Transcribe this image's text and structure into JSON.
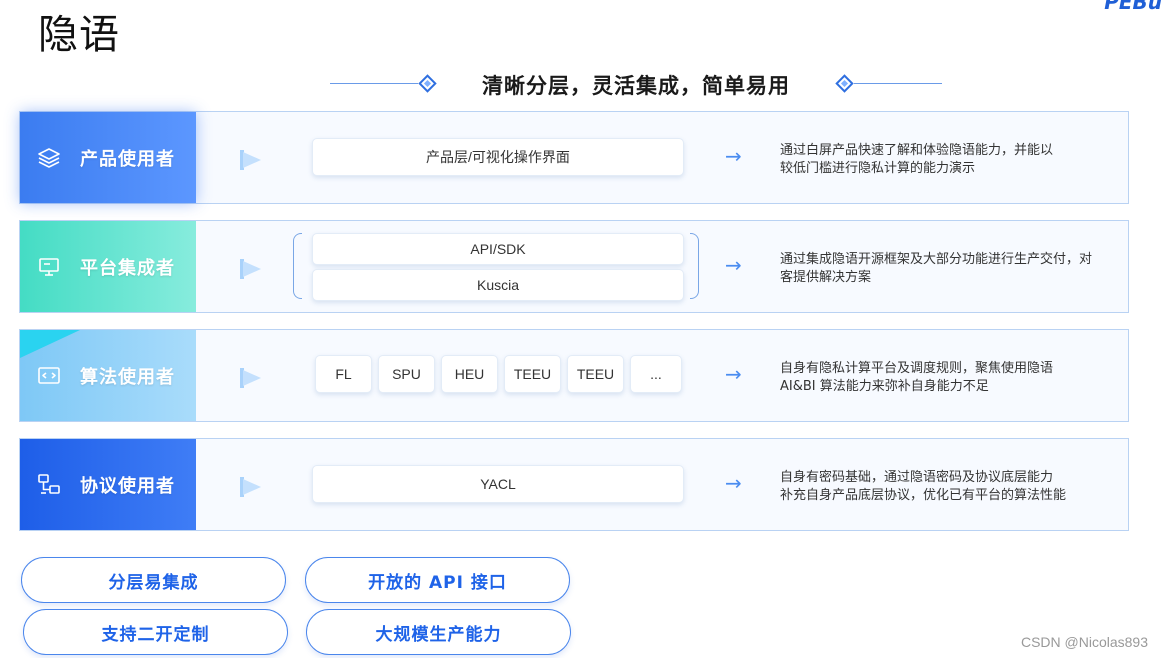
{
  "page_title": "隐语",
  "corner_logo": "PEBu",
  "subtitle": "清晰分层，灵活集成，简单易用",
  "layers": [
    {
      "role": "产品使用者",
      "icon": "layers-icon",
      "components": [
        "产品层/可视化操作界面"
      ],
      "description_lines": [
        "通过白屏产品快速了解和体验隐语能力，并能以",
        "较低门槛进行隐私计算的能力演示"
      ]
    },
    {
      "role": "平台集成者",
      "icon": "monitor-icon",
      "components": [
        "API/SDK",
        "Kuscia"
      ],
      "description_lines": [
        "通过集成隐语开源框架及大部分功能进行生产交付，对",
        "客提供解决方案"
      ]
    },
    {
      "role": "算法使用者",
      "icon": "code-window-icon",
      "components": [
        "FL",
        "SPU",
        "HEU",
        "TEEU",
        "TEEU",
        "..."
      ],
      "description_lines": [
        "自身有隐私计算平台及调度规则，聚焦使用隐语",
        "AI&BI 算法能力来弥补自身能力不足"
      ]
    },
    {
      "role": "协议使用者",
      "icon": "network-icon",
      "components": [
        "YACL"
      ],
      "description_lines": [
        "自身有密码基础，通过隐语密码及协议底层能力",
        "补充自身产品底层协议，优化已有平台的算法性能"
      ]
    }
  ],
  "arrow_glyph": "→",
  "features": [
    "分层易集成",
    "开放的 API 接口",
    "支持二开定制",
    "大规模生产能力"
  ],
  "watermark": "CSDN @Nicolas893",
  "colors": {
    "accent_blue": "#1f63e8",
    "row_border": "#b9d2f3",
    "teal": "#44dcc4",
    "light_blue": "#7ec8f6"
  }
}
